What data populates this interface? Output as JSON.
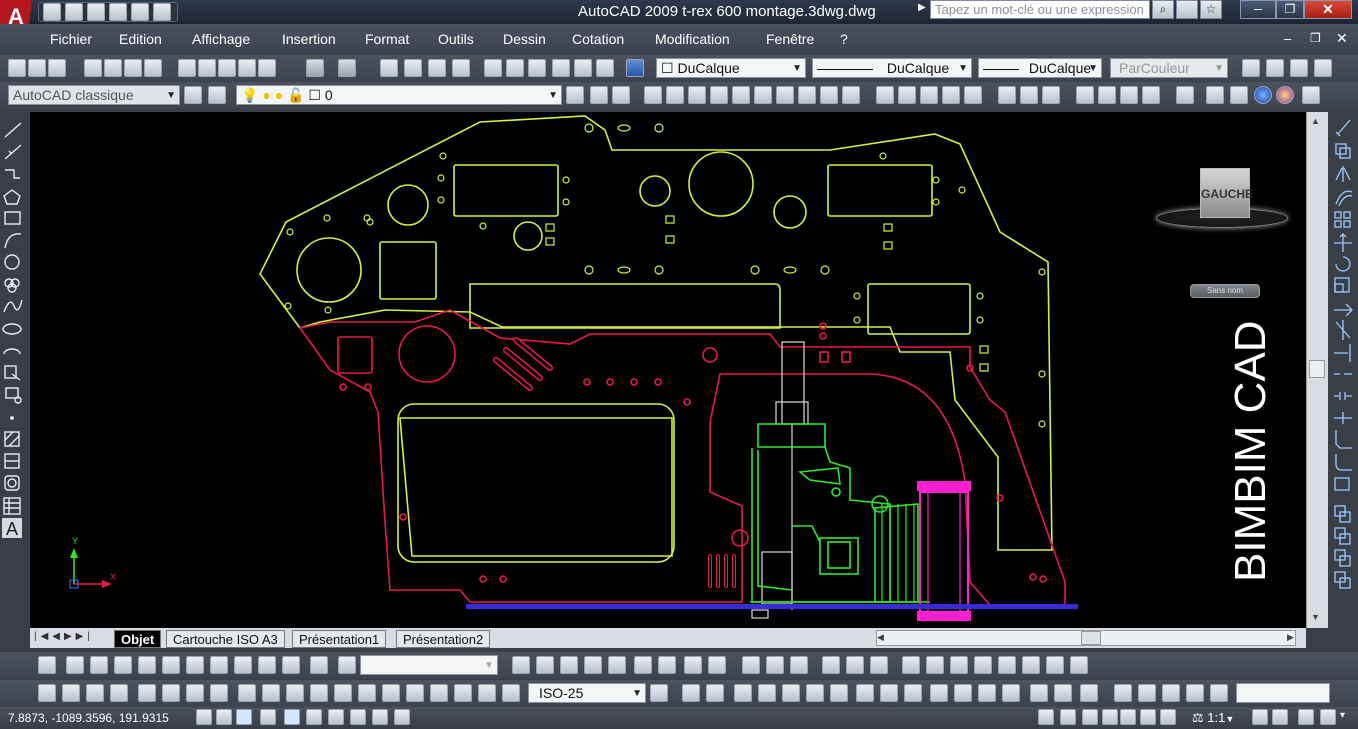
{
  "titlebar": {
    "title": "AutoCAD 2009  t-rex 600 montage.3dwg.dwg",
    "search_placeholder": "Tapez un mot-clé ou une expression"
  },
  "menu": {
    "items": [
      "Fichier",
      "Edition",
      "Affichage",
      "Insertion",
      "Format",
      "Outils",
      "Dessin",
      "Cotation",
      "Modification",
      "Fenêtre",
      "?"
    ]
  },
  "properties": {
    "color": "DuCalque",
    "linetype": "DuCalque",
    "lineweight": "DuCalque",
    "plotstyle": "ParCouleur"
  },
  "workspace": {
    "name": "AutoCAD classique",
    "layer": "0"
  },
  "dimension": {
    "style": "ISO-25"
  },
  "viewcube": {
    "face_label": "GAUCHE",
    "ucs_label": "Sans nom"
  },
  "canvas": {
    "watermark": "BIMBIM CAD",
    "axis_y": "Y",
    "axis_x": "X"
  },
  "layout_tabs": [
    "Objet",
    "Cartouche ISO A3",
    "Présentation1",
    "Présentation2"
  ],
  "status": {
    "coordinates": "7.8873, -1089.3596, 191.9315",
    "scale": "1:1"
  },
  "colors": {
    "canvas": "#000000",
    "frame_outer": "#d7ef3f",
    "frame_inner": "#e8194f",
    "engine": "#2ee82e",
    "clutch": "#ff1fd1",
    "base_line": "#3a2bd8"
  }
}
